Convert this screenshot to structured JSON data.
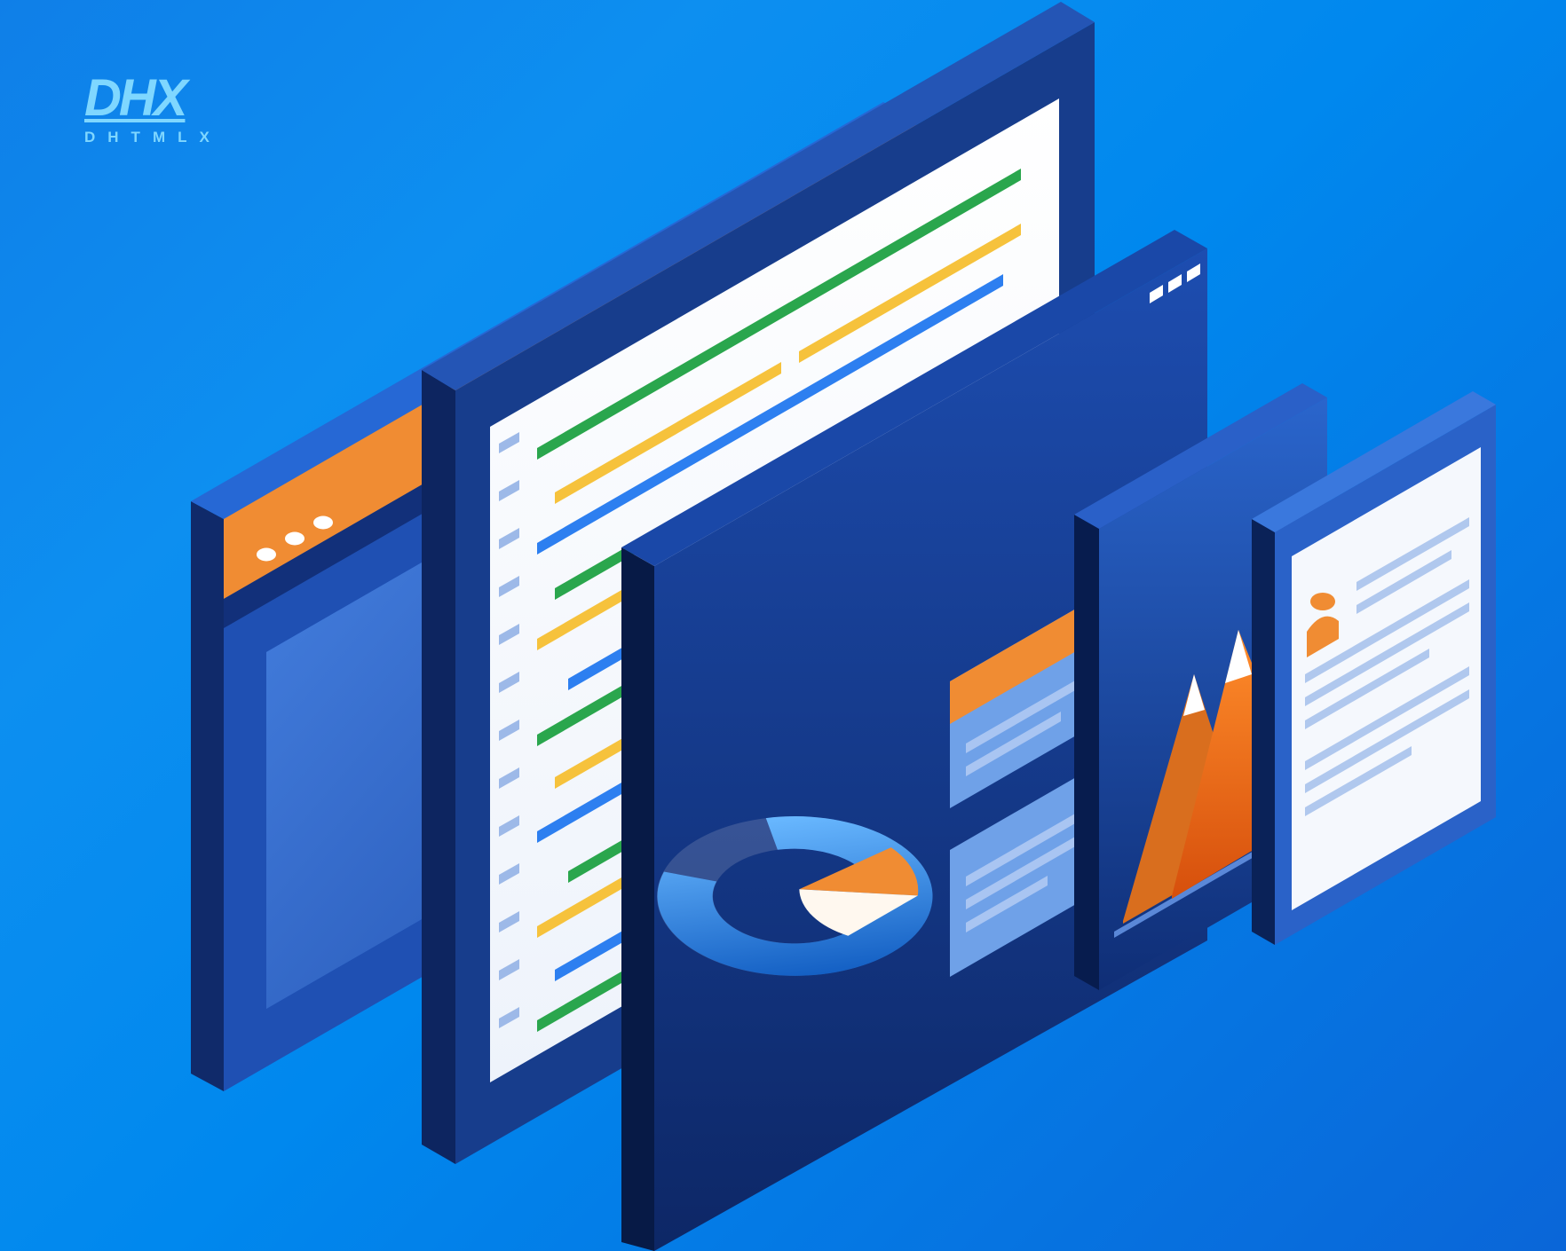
{
  "logo": {
    "name": "DHX",
    "subtitle": "DHTMLX"
  },
  "colors": {
    "bg_start": "#0f7fe8",
    "bg_end": "#0a66d8",
    "panel_dark": "#173d8c",
    "panel_mid": "#2158bc",
    "panel_light": "#3272d8",
    "orange": "#f08c33",
    "orange_dark": "#d96e1e",
    "green": "#2aa64d",
    "yellow": "#f6c23c",
    "blue_line": "#2d7ff0",
    "white": "#ffffff",
    "pale_blue": "#b0c8ee",
    "card_blue": "#6fa1e8"
  },
  "illustration": {
    "panels": [
      {
        "type": "browser-window",
        "dots": 3
      },
      {
        "type": "code-editor",
        "code_line_colors": [
          "green",
          "yellow",
          "blue",
          "green",
          "yellow",
          "blue",
          "green",
          "yellow",
          "blue",
          "green",
          "yellow",
          "blue",
          "green"
        ]
      },
      {
        "type": "dashboard",
        "dots": 3,
        "widgets": [
          "donut-chart",
          "card-stack"
        ]
      },
      {
        "type": "chart-panel",
        "widget": "area-peaks"
      },
      {
        "type": "profile-panel",
        "widget": "user-profile"
      }
    ]
  }
}
